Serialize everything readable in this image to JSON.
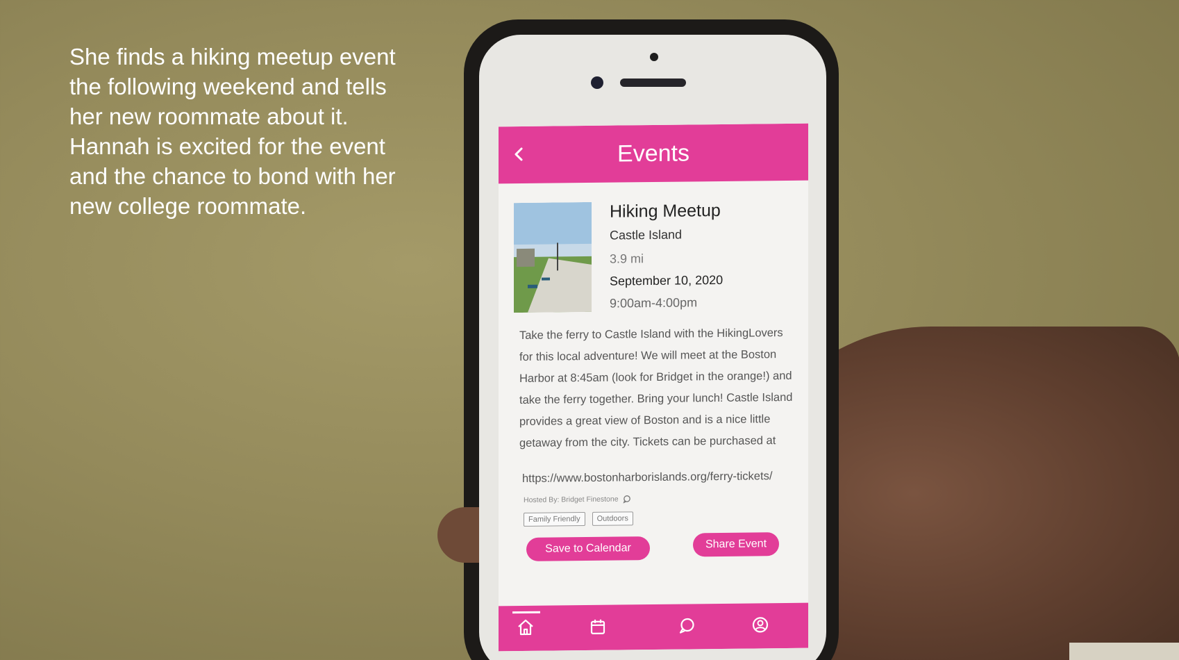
{
  "caption": {
    "lines": [
      "She finds a hiking meetup event",
      "the following weekend and tells",
      "her new roommate about it.",
      "Hannah is excited for the event",
      "and the chance to bond with her",
      "new college roommate."
    ]
  },
  "app": {
    "header_title": "Events",
    "accent_color": "#e23d98",
    "event": {
      "title": "Hiking Meetup",
      "location": "Castle Island",
      "distance": "3.9 mi",
      "date": "September 10, 2020",
      "time": "9:00am-4:00pm",
      "description": "Take the ferry to Castle Island with the HikingLovers for this local adventure! We will meet at the Boston Harbor at 8:45am (look for Bridget in the orange!) and take the ferry together. Bring your lunch! Castle Island provides a great view of Boston and is a nice little getaway from the city. Tickets can be purchased at",
      "url": "https://www.bostonharborislands.org/ferry-tickets/",
      "hosted_by": "Hosted By: Bridget Finestone",
      "tags": [
        "Family Friendly",
        "Outdoors"
      ]
    },
    "buttons": {
      "save_calendar": "Save to Calendar",
      "share_event": "Share Event"
    },
    "tabbar": {
      "icons": [
        "home-icon",
        "calendar-icon",
        "chat-icon",
        "profile-icon"
      ]
    }
  }
}
